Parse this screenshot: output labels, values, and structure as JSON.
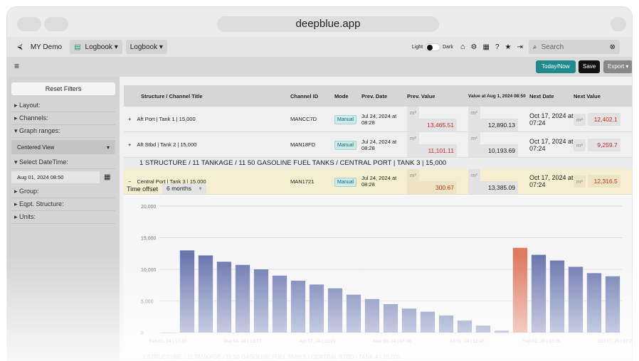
{
  "browser": {
    "url": "deepblue.app"
  },
  "toolbar": {
    "demo": "MY Demo",
    "logbook1": "Logbook ▾",
    "logbook2": "Logbook ▾",
    "light": "Light",
    "dark": "Dark",
    "search_placeholder": "Search"
  },
  "subbar": {
    "today": "Today/Now",
    "save": "Save",
    "export": "Export ▾"
  },
  "sidebar": {
    "reset": "Reset Filters",
    "layout": "▸ Layout:",
    "channels": "▸ Channels:",
    "graph_ranges": "▾ Graph ranges:",
    "centered_view": "Centered View",
    "select_datetime": "▾ Select DateTime:",
    "datetime_value": "Aug 01, 2024 08:50",
    "group": "▸ Group:",
    "eqpt": "▸ Eqpt. Structure:",
    "units": "▸ Units:"
  },
  "table": {
    "headers": [
      "Structure / Channel Title",
      "Channel ID",
      "Mode",
      "Prev. Date",
      "Prev. Value",
      "Value at Aug 1, 2024 08:50",
      "Next Date",
      "Next Value"
    ],
    "rows": [
      {
        "exp": "+",
        "title": "Aft Port | Tank 1 | 15,000",
        "id": "MANCC7D",
        "mode": "Manual",
        "prev_date": "Jul 24, 2024 at 08:28",
        "prev_unit": "m³",
        "prev_val": "13,465.51",
        "cur_unit": "m³",
        "cur_val": "12,890.13",
        "next_date": "Oct 17, 2024 at 07:24",
        "next_unit": "m³",
        "next_val": "12,402.1"
      },
      {
        "exp": "+",
        "title": "Aft Stbd | Tank 2 | 15,000",
        "id": "MAN18FD",
        "mode": "Manual",
        "prev_date": "Jul 24, 2024 at 08:28",
        "prev_unit": "m³",
        "prev_val": "11,101.11",
        "cur_unit": "m³",
        "cur_val": "10,193.69",
        "next_date": "Oct 17, 2024 at 07:24",
        "next_unit": "m³",
        "next_val": "9,259.7"
      }
    ],
    "section": "1 STRUCTURE / 11 TANKAGE / 11 50 GASOLINE FUEL TANKS / CENTRAL PORT | TANK 3 | 15,000",
    "selected": {
      "exp": "−",
      "title": "Central Port | Tank 3 | 15,000",
      "id": "MAN1721",
      "mode": "Manual",
      "prev_date": "Jul 24, 2024 at 08:28",
      "prev_unit": "m³",
      "prev_val": "300.67",
      "cur_unit": "m³",
      "cur_val": "13,385.09",
      "next_date": "Oct 17, 2024 at 07:24",
      "next_unit": "m³",
      "next_val": "12,316.5"
    }
  },
  "chart_controls": {
    "label": "Time offset",
    "select": "6 months"
  },
  "chart_data": {
    "type": "bar",
    "x_tick_labels": [
      "Feb 01, 24 | 17:10",
      "Mar 04, 24 | 13:17",
      "Apr 17, 24 | 11:19",
      "May 30, 24 | 07:48",
      "Jul 01, 24 | 12:48",
      "Sep 02, 24 | 13:16",
      "Oct 17, 24 | 07:24"
    ],
    "y_ticks": [
      0,
      5000,
      10000,
      15000,
      20000
    ],
    "y_tick_labels": [
      "0",
      "5,000",
      "10,000",
      "15,000",
      "20,000"
    ],
    "ylim": [
      0,
      20000
    ],
    "values": [
      0,
      13000,
      12200,
      11200,
      10700,
      10000,
      9000,
      8200,
      7600,
      7000,
      6000,
      5300,
      4500,
      3800,
      3300,
      2700,
      1900,
      1100,
      300,
      13400,
      12300,
      11400,
      10400,
      9400,
      8900
    ],
    "highlight_index": 19,
    "colors": {
      "normal": "#6b78b0",
      "highlight": "#e07a60"
    }
  },
  "footer_section": "1 STRUCTURE / 11 TANKAGE / 11 50 GASOLINE FUEL TANKS / CENTRAL STBD | TANK 4 | 15,000"
}
